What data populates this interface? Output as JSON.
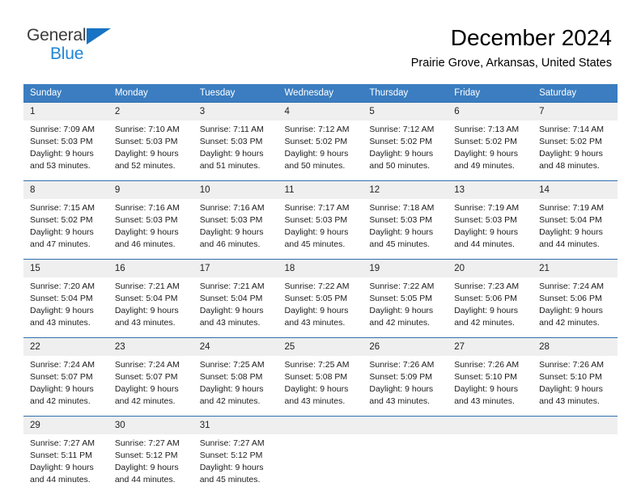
{
  "brand": {
    "name_part1": "General",
    "name_part2": "Blue",
    "triangle_color": "#1773c4",
    "blue_color": "#1f86d9"
  },
  "header": {
    "title": "December 2024",
    "subtitle": "Prairie Grove, Arkansas, United States"
  },
  "theme": {
    "header_row_bg": "#3b7dc0",
    "daynum_bg": "#efefef",
    "grid_line": "#2f6fae"
  },
  "weekdays": [
    "Sunday",
    "Monday",
    "Tuesday",
    "Wednesday",
    "Thursday",
    "Friday",
    "Saturday"
  ],
  "weeks": [
    [
      {
        "day": "1",
        "sunrise": "Sunrise: 7:09 AM",
        "sunset": "Sunset: 5:03 PM",
        "daylight1": "Daylight: 9 hours",
        "daylight2": "and 53 minutes."
      },
      {
        "day": "2",
        "sunrise": "Sunrise: 7:10 AM",
        "sunset": "Sunset: 5:03 PM",
        "daylight1": "Daylight: 9 hours",
        "daylight2": "and 52 minutes."
      },
      {
        "day": "3",
        "sunrise": "Sunrise: 7:11 AM",
        "sunset": "Sunset: 5:03 PM",
        "daylight1": "Daylight: 9 hours",
        "daylight2": "and 51 minutes."
      },
      {
        "day": "4",
        "sunrise": "Sunrise: 7:12 AM",
        "sunset": "Sunset: 5:02 PM",
        "daylight1": "Daylight: 9 hours",
        "daylight2": "and 50 minutes."
      },
      {
        "day": "5",
        "sunrise": "Sunrise: 7:12 AM",
        "sunset": "Sunset: 5:02 PM",
        "daylight1": "Daylight: 9 hours",
        "daylight2": "and 50 minutes."
      },
      {
        "day": "6",
        "sunrise": "Sunrise: 7:13 AM",
        "sunset": "Sunset: 5:02 PM",
        "daylight1": "Daylight: 9 hours",
        "daylight2": "and 49 minutes."
      },
      {
        "day": "7",
        "sunrise": "Sunrise: 7:14 AM",
        "sunset": "Sunset: 5:02 PM",
        "daylight1": "Daylight: 9 hours",
        "daylight2": "and 48 minutes."
      }
    ],
    [
      {
        "day": "8",
        "sunrise": "Sunrise: 7:15 AM",
        "sunset": "Sunset: 5:02 PM",
        "daylight1": "Daylight: 9 hours",
        "daylight2": "and 47 minutes."
      },
      {
        "day": "9",
        "sunrise": "Sunrise: 7:16 AM",
        "sunset": "Sunset: 5:03 PM",
        "daylight1": "Daylight: 9 hours",
        "daylight2": "and 46 minutes."
      },
      {
        "day": "10",
        "sunrise": "Sunrise: 7:16 AM",
        "sunset": "Sunset: 5:03 PM",
        "daylight1": "Daylight: 9 hours",
        "daylight2": "and 46 minutes."
      },
      {
        "day": "11",
        "sunrise": "Sunrise: 7:17 AM",
        "sunset": "Sunset: 5:03 PM",
        "daylight1": "Daylight: 9 hours",
        "daylight2": "and 45 minutes."
      },
      {
        "day": "12",
        "sunrise": "Sunrise: 7:18 AM",
        "sunset": "Sunset: 5:03 PM",
        "daylight1": "Daylight: 9 hours",
        "daylight2": "and 45 minutes."
      },
      {
        "day": "13",
        "sunrise": "Sunrise: 7:19 AM",
        "sunset": "Sunset: 5:03 PM",
        "daylight1": "Daylight: 9 hours",
        "daylight2": "and 44 minutes."
      },
      {
        "day": "14",
        "sunrise": "Sunrise: 7:19 AM",
        "sunset": "Sunset: 5:04 PM",
        "daylight1": "Daylight: 9 hours",
        "daylight2": "and 44 minutes."
      }
    ],
    [
      {
        "day": "15",
        "sunrise": "Sunrise: 7:20 AM",
        "sunset": "Sunset: 5:04 PM",
        "daylight1": "Daylight: 9 hours",
        "daylight2": "and 43 minutes."
      },
      {
        "day": "16",
        "sunrise": "Sunrise: 7:21 AM",
        "sunset": "Sunset: 5:04 PM",
        "daylight1": "Daylight: 9 hours",
        "daylight2": "and 43 minutes."
      },
      {
        "day": "17",
        "sunrise": "Sunrise: 7:21 AM",
        "sunset": "Sunset: 5:04 PM",
        "daylight1": "Daylight: 9 hours",
        "daylight2": "and 43 minutes."
      },
      {
        "day": "18",
        "sunrise": "Sunrise: 7:22 AM",
        "sunset": "Sunset: 5:05 PM",
        "daylight1": "Daylight: 9 hours",
        "daylight2": "and 43 minutes."
      },
      {
        "day": "19",
        "sunrise": "Sunrise: 7:22 AM",
        "sunset": "Sunset: 5:05 PM",
        "daylight1": "Daylight: 9 hours",
        "daylight2": "and 42 minutes."
      },
      {
        "day": "20",
        "sunrise": "Sunrise: 7:23 AM",
        "sunset": "Sunset: 5:06 PM",
        "daylight1": "Daylight: 9 hours",
        "daylight2": "and 42 minutes."
      },
      {
        "day": "21",
        "sunrise": "Sunrise: 7:24 AM",
        "sunset": "Sunset: 5:06 PM",
        "daylight1": "Daylight: 9 hours",
        "daylight2": "and 42 minutes."
      }
    ],
    [
      {
        "day": "22",
        "sunrise": "Sunrise: 7:24 AM",
        "sunset": "Sunset: 5:07 PM",
        "daylight1": "Daylight: 9 hours",
        "daylight2": "and 42 minutes."
      },
      {
        "day": "23",
        "sunrise": "Sunrise: 7:24 AM",
        "sunset": "Sunset: 5:07 PM",
        "daylight1": "Daylight: 9 hours",
        "daylight2": "and 42 minutes."
      },
      {
        "day": "24",
        "sunrise": "Sunrise: 7:25 AM",
        "sunset": "Sunset: 5:08 PM",
        "daylight1": "Daylight: 9 hours",
        "daylight2": "and 42 minutes."
      },
      {
        "day": "25",
        "sunrise": "Sunrise: 7:25 AM",
        "sunset": "Sunset: 5:08 PM",
        "daylight1": "Daylight: 9 hours",
        "daylight2": "and 43 minutes."
      },
      {
        "day": "26",
        "sunrise": "Sunrise: 7:26 AM",
        "sunset": "Sunset: 5:09 PM",
        "daylight1": "Daylight: 9 hours",
        "daylight2": "and 43 minutes."
      },
      {
        "day": "27",
        "sunrise": "Sunrise: 7:26 AM",
        "sunset": "Sunset: 5:10 PM",
        "daylight1": "Daylight: 9 hours",
        "daylight2": "and 43 minutes."
      },
      {
        "day": "28",
        "sunrise": "Sunrise: 7:26 AM",
        "sunset": "Sunset: 5:10 PM",
        "daylight1": "Daylight: 9 hours",
        "daylight2": "and 43 minutes."
      }
    ],
    [
      {
        "day": "29",
        "sunrise": "Sunrise: 7:27 AM",
        "sunset": "Sunset: 5:11 PM",
        "daylight1": "Daylight: 9 hours",
        "daylight2": "and 44 minutes."
      },
      {
        "day": "30",
        "sunrise": "Sunrise: 7:27 AM",
        "sunset": "Sunset: 5:12 PM",
        "daylight1": "Daylight: 9 hours",
        "daylight2": "and 44 minutes."
      },
      {
        "day": "31",
        "sunrise": "Sunrise: 7:27 AM",
        "sunset": "Sunset: 5:12 PM",
        "daylight1": "Daylight: 9 hours",
        "daylight2": "and 45 minutes."
      },
      {
        "day": "",
        "sunrise": "",
        "sunset": "",
        "daylight1": "",
        "daylight2": ""
      },
      {
        "day": "",
        "sunrise": "",
        "sunset": "",
        "daylight1": "",
        "daylight2": ""
      },
      {
        "day": "",
        "sunrise": "",
        "sunset": "",
        "daylight1": "",
        "daylight2": ""
      },
      {
        "day": "",
        "sunrise": "",
        "sunset": "",
        "daylight1": "",
        "daylight2": ""
      }
    ]
  ]
}
